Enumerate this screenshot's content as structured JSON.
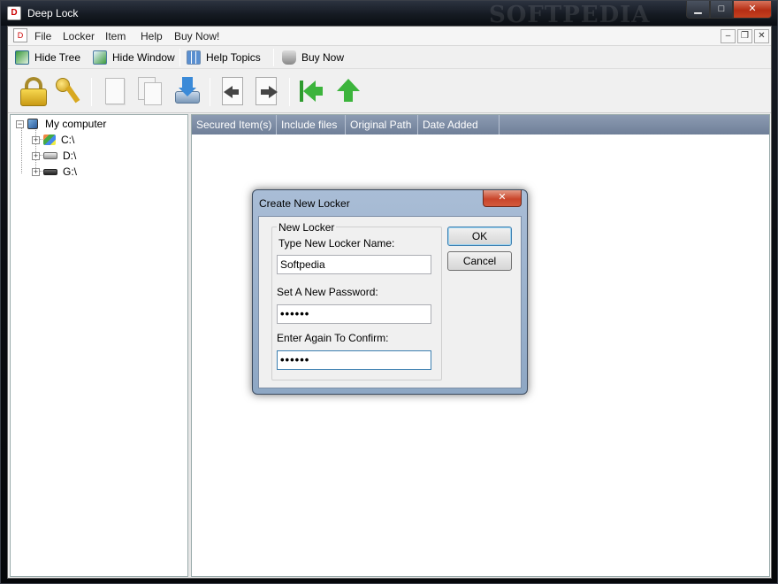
{
  "window": {
    "title": "Deep Lock",
    "watermark": "SOFTPEDIA"
  },
  "menu": {
    "items": [
      "File",
      "Locker",
      "Item",
      "Help",
      "Buy Now!"
    ]
  },
  "toolbar": {
    "hide_tree": "Hide Tree",
    "hide_window": "Hide Window",
    "help_topics": "Help Topics",
    "buy_now": "Buy Now"
  },
  "big_toolbar": {
    "icons": [
      "lock-icon",
      "key-icon",
      "document-icon",
      "copy-icon",
      "save-icon",
      "back-icon",
      "forward-icon",
      "first-icon",
      "up-icon"
    ]
  },
  "tree": {
    "root": "My computer",
    "drives": [
      "C:\\",
      "D:\\",
      "G:\\"
    ]
  },
  "list": {
    "columns": [
      "Secured Item(s)",
      "Include files",
      "Original Path",
      "Date Added"
    ]
  },
  "dialog": {
    "title": "Create New Locker",
    "group_label": "New Locker",
    "name_label": "Type New Locker Name:",
    "name_value": "Softpedia",
    "password_label": "Set A New Password:",
    "password_value": "••••••",
    "confirm_label": "Enter Again To Confirm:",
    "confirm_value": "••••••",
    "ok": "OK",
    "cancel": "Cancel"
  },
  "colors": {
    "list_header": "#7d8da5",
    "dialog_frame": "#9fb4cf",
    "close_button": "#c9452a"
  }
}
